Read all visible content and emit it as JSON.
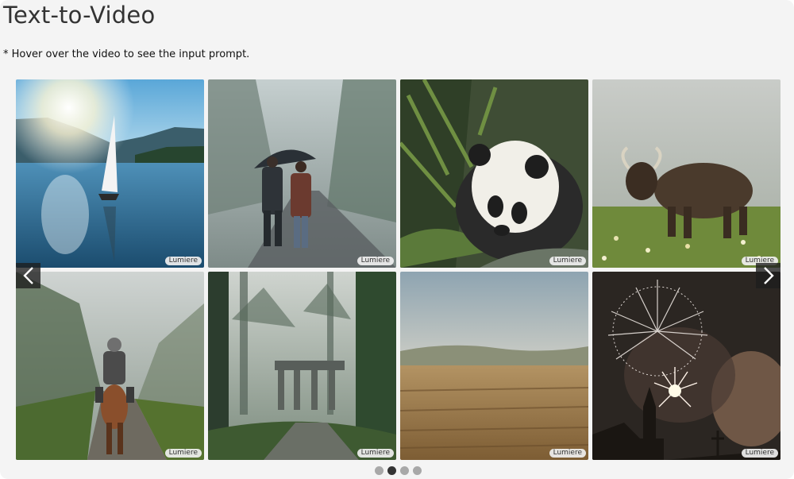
{
  "section": {
    "title": "Text-to-Video",
    "note": "* Hover over the video to see the input prompt."
  },
  "gallery": {
    "badge_label": "Lumiere",
    "tiles": [
      {
        "name": "tile-sailboat",
        "badge": "Lumiere"
      },
      {
        "name": "tile-couple-umbrella",
        "badge": "Lumiere"
      },
      {
        "name": "tile-panda",
        "badge": "Lumiere"
      },
      {
        "name": "tile-yak",
        "badge": "Lumiere"
      },
      {
        "name": "tile-knight-horse",
        "badge": "Lumiere"
      },
      {
        "name": "tile-forest-ruins",
        "badge": "Lumiere"
      },
      {
        "name": "tile-wheat-field",
        "badge": "Lumiere"
      },
      {
        "name": "tile-fireworks-church",
        "badge": "Lumiere"
      }
    ],
    "pagination": {
      "count": 4,
      "active_index": 1
    }
  },
  "icons": {
    "prev": "chevron-left-icon",
    "next": "chevron-right-icon"
  },
  "colors": {
    "card_bg": "#f4f4f4",
    "dot_active": "#333333",
    "dot_inactive": "#a8a8a8",
    "arrow_bg": "#1e1e1e"
  }
}
